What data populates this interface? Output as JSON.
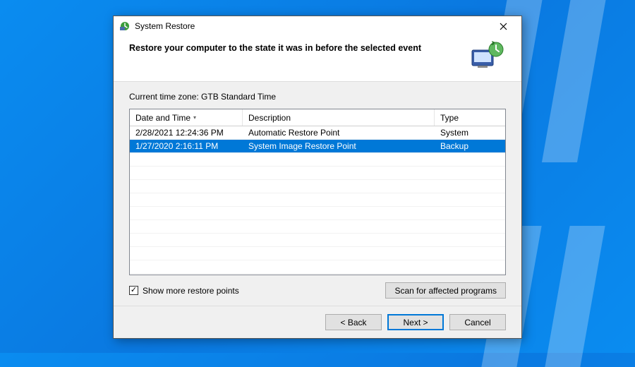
{
  "window": {
    "title": "System Restore"
  },
  "header": {
    "heading": "Restore your computer to the state it was in before the selected event"
  },
  "timezone_label": "Current time zone: GTB Standard Time",
  "columns": {
    "date": "Date and Time",
    "desc": "Description",
    "type": "Type"
  },
  "rows": [
    {
      "date": "2/28/2021 12:24:36 PM",
      "desc": "Automatic Restore Point",
      "type": "System",
      "selected": false
    },
    {
      "date": "1/27/2020 2:16:11 PM",
      "desc": "System Image Restore Point",
      "type": "Backup",
      "selected": true
    }
  ],
  "show_more": {
    "checked": true,
    "label": "Show more restore points"
  },
  "scan_button": "Scan for affected programs",
  "buttons": {
    "back": "< Back",
    "next": "Next >",
    "cancel": "Cancel"
  }
}
